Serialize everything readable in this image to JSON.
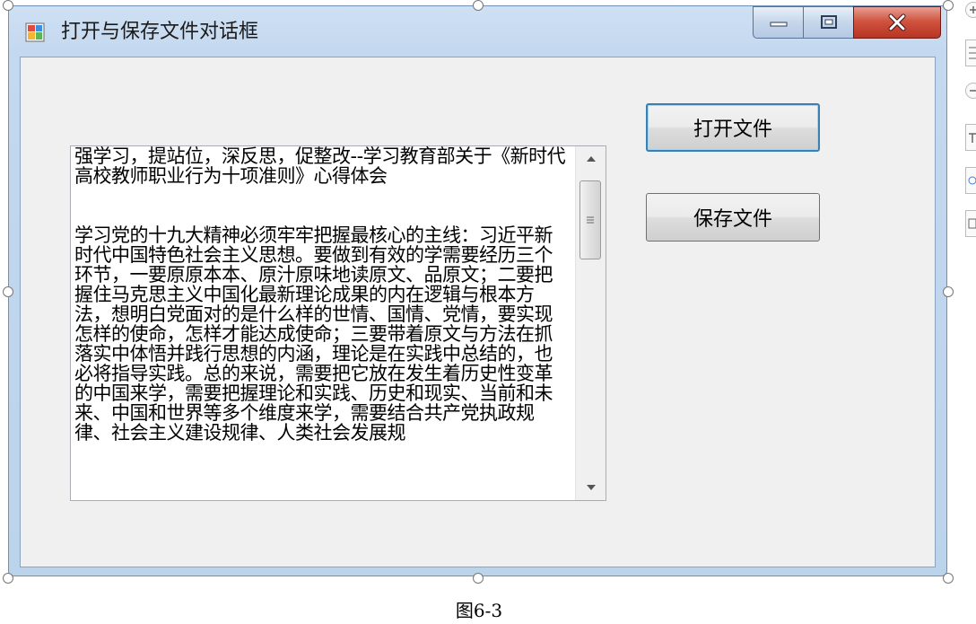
{
  "window": {
    "title": "打开与保存文件对话框",
    "controls": {
      "minimize": "minimize-icon",
      "maximize": "maximize-icon",
      "close": "close-icon"
    }
  },
  "textbox": {
    "content": "强学习，提站位，深反思，促整改--学习教育部关于《新时代高校教师职业行为十项准则》心得体会\n\n\n学习党的十九大精神必须牢牢把握最核心的主线：习近平新时代中国特色社会主义思想。要做到有效的学需要经历三个环节，一要原原本本、原汁原味地读原文、品原文；二要把握住马克思主义中国化最新理论成果的内在逻辑与根本方法，想明白党面对的是什么样的世情、国情、党情，要实现怎样的使命，怎样才能达成使命；三要带着原文与方法在抓落实中体悟并践行思想的内涵，理论是在实践中总结的，也必将指导实践。总的来说，需要把它放在发生着历史性变革的中国来学，需要把握理论和实践、历史和现实、当前和未来、中国和世界等多个维度来学，需要结合共产党执政规律、社会主义建设规律、人类社会发展规"
  },
  "buttons": {
    "open": "打开文件",
    "save": "保存文件"
  },
  "caption": "图6-3",
  "colors": {
    "title_bar": "#c4d8ef",
    "client_bg": "#f0f0f0",
    "close_button": "#c94a37",
    "focus_border": "#3c7fb1"
  }
}
